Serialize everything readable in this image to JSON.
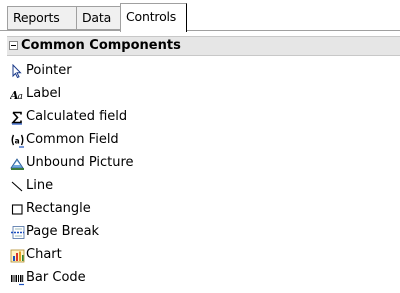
{
  "tabs": [
    {
      "label": "Reports"
    },
    {
      "label": "Data"
    },
    {
      "label": "Controls"
    }
  ],
  "active_tab": "Controls",
  "group": {
    "label": "Common Components",
    "icon": "collapse-minus-icon"
  },
  "items": [
    {
      "label": "Pointer",
      "icon": "pointer-arrow-icon"
    },
    {
      "label": "Label",
      "icon": "label-aa-icon"
    },
    {
      "label": "Calculated field",
      "icon": "sigma-icon"
    },
    {
      "label": "Common Field",
      "icon": "common-field-icon"
    },
    {
      "label": "Unbound Picture",
      "icon": "picture-icon"
    },
    {
      "label": "Line",
      "icon": "line-icon"
    },
    {
      "label": "Rectangle",
      "icon": "rectangle-icon"
    },
    {
      "label": "Page Break",
      "icon": "page-break-icon"
    },
    {
      "label": "Chart",
      "icon": "chart-icon"
    },
    {
      "label": "Bar Code",
      "icon": "barcode-icon"
    }
  ]
}
